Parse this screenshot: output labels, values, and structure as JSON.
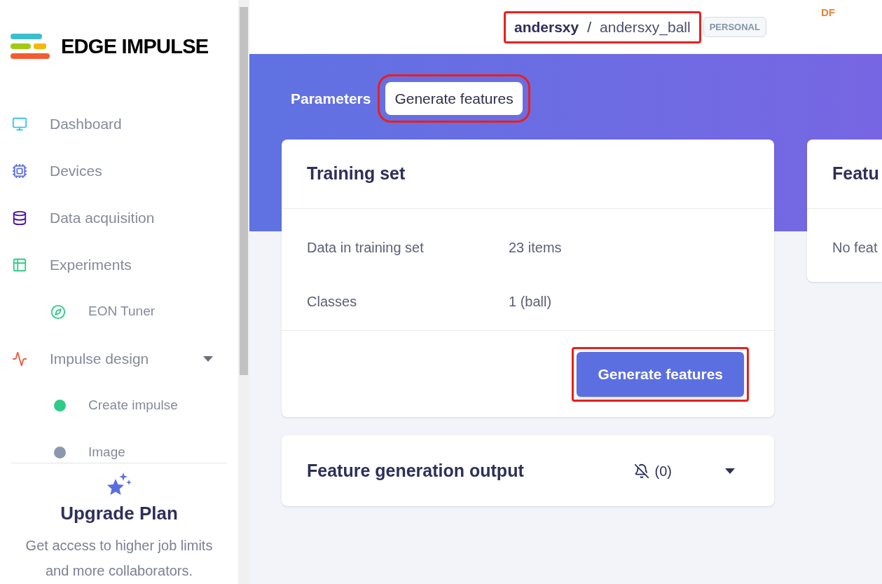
{
  "sidebar": {
    "logo_text": "EDGE IMPULSE",
    "items": [
      {
        "kind": "main",
        "label": "Dashboard",
        "color": "#3bc6e6"
      },
      {
        "kind": "main",
        "label": "Devices",
        "color": "#5c6fe0"
      },
      {
        "kind": "main",
        "label": "Data acquisition",
        "color": "#4a0fa8"
      },
      {
        "kind": "main",
        "label": "Experiments",
        "color": "#2ecc88"
      },
      {
        "kind": "sub",
        "label": "EON Tuner",
        "color": "#2ecc88"
      },
      {
        "kind": "main",
        "label": "Impulse design",
        "color": "#f05a3a",
        "expanded": true
      },
      {
        "kind": "status",
        "label": "Create impulse",
        "color": "#2ecc88"
      },
      {
        "kind": "status",
        "label": "Image",
        "color": "#8a98ad"
      }
    ],
    "upgrade": {
      "title": "Upgrade Plan",
      "text": "Get access to higher job limits and more collaborators."
    }
  },
  "header": {
    "owner": "andersxy",
    "separator": "/",
    "project": "andersxy_ball",
    "badge": "PERSONAL",
    "user_initials": "DF"
  },
  "tabs": [
    {
      "label": "Parameters",
      "selected": false
    },
    {
      "label": "Generate features",
      "selected": true
    }
  ],
  "training_card": {
    "title": "Training set",
    "rows": [
      {
        "label": "Data in training set",
        "value": "23 items"
      },
      {
        "label": "Classes",
        "value": "1 (ball)"
      }
    ],
    "button": "Generate features"
  },
  "side_card": {
    "title": "Featu",
    "text": "No feat"
  },
  "output_card": {
    "title": "Feature generation output",
    "count": "(0)",
    "expanded": false
  }
}
